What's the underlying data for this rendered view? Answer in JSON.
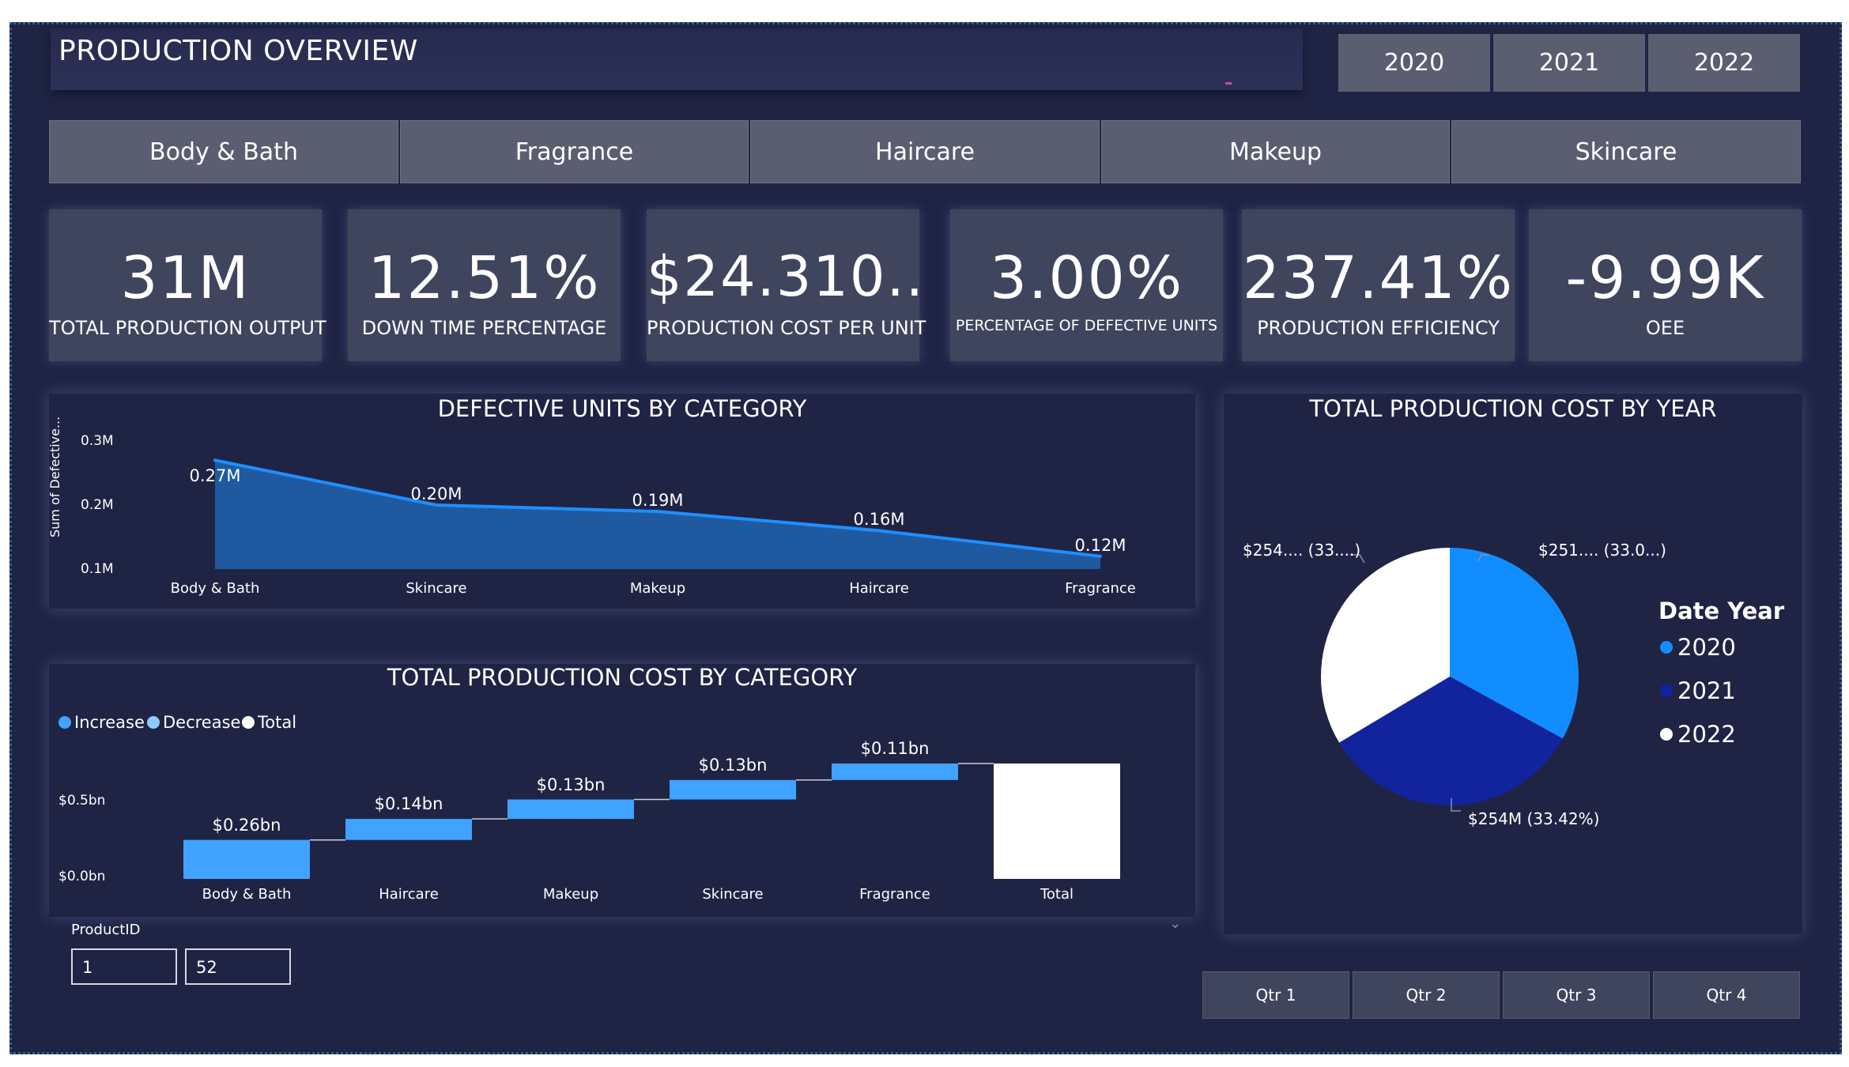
{
  "header": {
    "title": "PRODUCTION OVERVIEW"
  },
  "years": [
    "2020",
    "2021",
    "2022"
  ],
  "categories": [
    "Body & Bath",
    "Fragrance",
    "Haircare",
    "Makeup",
    "Skincare"
  ],
  "kpis": [
    {
      "value": "31M",
      "label": "TOTAL PRODUCTION OUTPUT"
    },
    {
      "value": "12.51%",
      "label": "DOWN TIME PERCENTAGE"
    },
    {
      "value": "$24.310...",
      "label": "PRODUCTION COST PER UNIT"
    },
    {
      "value": "3.00%",
      "label": "PERCENTAGE OF DEFECTIVE UNITS"
    },
    {
      "value": "237.41%",
      "label": "PRODUCTION EFFICIENCY"
    },
    {
      "value": "-9.99K",
      "label": "OEE"
    }
  ],
  "defective_chart": {
    "title": "DEFECTIVE UNITS BY CATEGORY",
    "ylabel": "Sum of Defective...",
    "yticks": [
      "0.3M",
      "0.2M",
      "0.1M"
    ]
  },
  "waterfall_chart": {
    "title": "TOTAL PRODUCTION COST BY CATEGORY",
    "legend": [
      "Increase",
      "Decrease",
      "Total"
    ],
    "yticks": [
      "$0.5bn",
      "$0.0bn"
    ]
  },
  "pie_chart": {
    "title": "TOTAL PRODUCTION COST BY YEAR",
    "legend_title": "Date Year",
    "labels": [
      "$251.... (33.0...)",
      "$254M (33.42%)",
      "$254.... (33....)"
    ]
  },
  "slicer": {
    "label": "ProductID",
    "min": "1",
    "max": "52"
  },
  "quarters": [
    "Qtr 1",
    "Qtr 2",
    "Qtr 3",
    "Qtr 4"
  ],
  "colors": {
    "background": "#1f2445",
    "area": "#1f5aa0",
    "line": "#1e8fff",
    "increase": "#3fa3ff",
    "total": "#ffffff",
    "pie_2020": "#118dff",
    "pie_2021": "#12239e",
    "pie_2022": "#ffffff"
  },
  "chart_data": [
    {
      "type": "area",
      "title": "DEFECTIVE UNITS BY CATEGORY",
      "ylabel": "Sum of Defective...",
      "categories": [
        "Body & Bath",
        "Skincare",
        "Makeup",
        "Haircare",
        "Fragrance"
      ],
      "values": [
        0.27,
        0.2,
        0.19,
        0.16,
        0.12
      ],
      "value_labels": [
        "0.27M",
        "0.20M",
        "0.19M",
        "0.16M",
        "0.12M"
      ],
      "ylim": [
        0.1,
        0.3
      ]
    },
    {
      "type": "bar",
      "subtype": "waterfall",
      "title": "TOTAL PRODUCTION COST BY CATEGORY",
      "categories": [
        "Body & Bath",
        "Haircare",
        "Makeup",
        "Skincare",
        "Fragrance",
        "Total"
      ],
      "values": [
        0.26,
        0.14,
        0.13,
        0.13,
        0.11,
        0.77
      ],
      "value_labels": [
        "$0.26bn",
        "$0.14bn",
        "$0.13bn",
        "$0.13bn",
        "$0.11bn",
        ""
      ],
      "ylim": [
        0,
        0.77
      ]
    },
    {
      "type": "pie",
      "title": "TOTAL PRODUCTION COST BY YEAR",
      "categories": [
        "2020",
        "2021",
        "2022"
      ],
      "values": [
        33.0,
        33.42,
        33.58
      ],
      "legend": "right"
    }
  ]
}
